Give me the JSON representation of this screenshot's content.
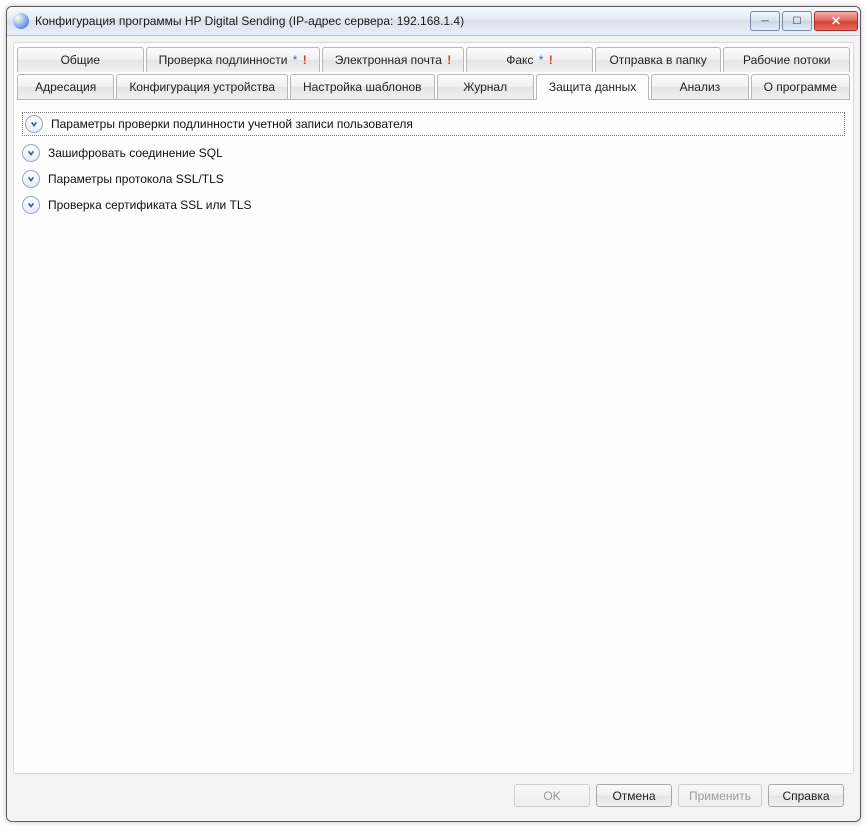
{
  "window": {
    "title": "Конфигурация программы HP Digital Sending (IP-адрес сервера: 192.168.1.4)"
  },
  "tabs_row1": [
    {
      "label": "Общие",
      "star": false,
      "bang": false,
      "active": false
    },
    {
      "label": "Проверка подлинности",
      "star": true,
      "bang": true,
      "active": false
    },
    {
      "label": "Электронная почта",
      "star": false,
      "bang": true,
      "active": false
    },
    {
      "label": "Факс",
      "star": true,
      "bang": true,
      "active": false
    },
    {
      "label": "Отправка в папку",
      "star": false,
      "bang": false,
      "active": false
    },
    {
      "label": "Рабочие потоки",
      "star": false,
      "bang": false,
      "active": false
    }
  ],
  "tabs_row2": [
    {
      "label": "Адресация",
      "active": false
    },
    {
      "label": "Конфигурация устройства",
      "active": false
    },
    {
      "label": "Настройка шаблонов",
      "active": false
    },
    {
      "label": "Журнал",
      "active": false
    },
    {
      "label": "Защита данных",
      "active": true
    },
    {
      "label": "Анализ",
      "active": false
    },
    {
      "label": "О программе",
      "active": false
    }
  ],
  "expanders": [
    {
      "label": "Параметры проверки подлинности учетной записи пользователя"
    },
    {
      "label": "Зашифровать соединение SQL"
    },
    {
      "label": "Параметры протокола SSL/TLS"
    },
    {
      "label": "Проверка сертификата SSL или TLS"
    }
  ],
  "buttons": {
    "ok": "OK",
    "cancel": "Отмена",
    "apply": "Применить",
    "help": "Справка"
  }
}
